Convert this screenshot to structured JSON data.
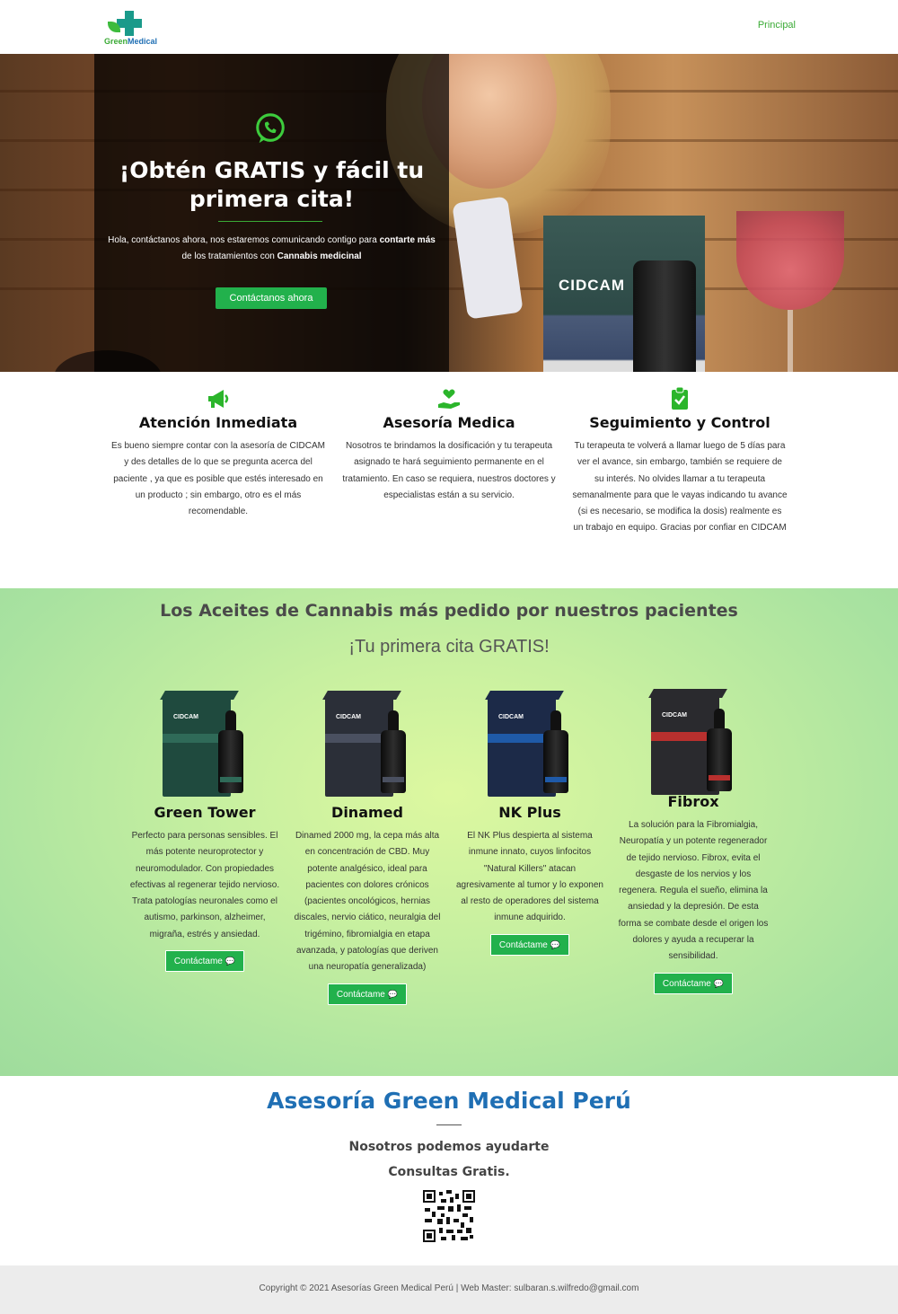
{
  "header": {
    "logo_green": "Green",
    "logo_medical": "Medical",
    "nav_principal": "Principal"
  },
  "hero": {
    "title": "¡Obtén GRATIS y fácil tu primera cita!",
    "text_1": "Hola, contáctanos ahora, nos estaremos comunicando contigo para ",
    "text_bold_1": "contarte más",
    "text_2": " de los tratamientos con ",
    "text_bold_2": "Cannabis medicinal",
    "cta_label": "Contáctanos ahora",
    "photo_box_label": "CIDCAM"
  },
  "features": [
    {
      "icon": "megaphone-icon",
      "title": "Atención Inmediata",
      "text": "Es bueno siempre contar con la asesoría de CIDCAM y des detalles de lo que se pregunta acerca del paciente , ya que es posible que estés interesado en un producto ; sin embargo, otro es el más recomendable."
    },
    {
      "icon": "hand-heart-icon",
      "title": "Asesoría Medica",
      "text": "Nosotros te brindamos la dosificación y tu terapeuta asignado te hará seguimiento permanente en el tratamiento. En caso se requiera, nuestros doctores y especialistas están a su servicio."
    },
    {
      "icon": "clipboard-check-icon",
      "title": "Seguimiento y Control",
      "text": "Tu terapeuta te volverá a llamar luego de 5 días para ver el avance, sin embargo, también se requiere de su interés. No olvides llamar a tu terapeuta semanalmente para que le vayas indicando tu avance (si es necesario, se modifica la dosis) realmente es un trabajo en equipo. Gracias por confiar en CIDCAM"
    }
  ],
  "products_section": {
    "title": "Los Aceites de Cannabis más pedido por nuestros pacientes",
    "subtitle": "¡Tu primera cita GRATIS!",
    "box_brand": "CIDCAM",
    "button_label": "Contáctame",
    "items": [
      {
        "name": "Green Tower",
        "color": "#1f4a3e",
        "band": "#2f6a58",
        "text": "Perfecto para personas sensibles. El más potente neuroprotector y neuromodulador. Con propiedades efectivas al regenerar tejido nervioso. Trata patologías neuronales como el autismo, parkinson, alzheimer, migraña, estrés y ansiedad."
      },
      {
        "name": "Dinamed",
        "color": "#2b2f38",
        "band": "#4a5060",
        "text": "Dinamed 2000 mg,  la cepa más alta en concentración de CBD. Muy potente analgésico, ideal para pacientes con dolores crónicos (pacientes oncológicos, hernias discales, nervio ciático, neuralgia del trigémino, fibromialgia en etapa avanzada, y patologías que deriven una neuropatía generalizada)"
      },
      {
        "name": "NK Plus",
        "color": "#1c2a48",
        "band": "#1f5aa8",
        "text": "El NK Plus despierta al sistema inmune innato, cuyos linfocitos \"Natural Killers\" atacan agresivamente al tumor y lo exponen al resto de operadores del sistema inmune adquirido."
      },
      {
        "name": "Fibrox",
        "color": "#2a2a2e",
        "band": "#b8302e",
        "text": "La solución para la Fibromialgia, Neuropatía y un potente regenerador de tejido nervioso. Fibrox, evita el desgaste de los nervios y los regenera. Regula el sueño, elimina la ansiedad y la depresión. De esta forma se combate desde el origen los dolores y ayuda a recuperar la sensibilidad."
      }
    ]
  },
  "asesoria": {
    "title": "Asesoría Green Medical Perú",
    "line_1": "Nosotros podemos ayudarte",
    "line_2": "Consultas Gratis."
  },
  "footer": {
    "text": "Copyright © 2021 Asesorías Green Medical Perú | Web Master: sulbaran.s.wilfredo@gmail.com"
  },
  "colors": {
    "accent_green": "#22b14c",
    "brand_blue": "#1f6fb4"
  }
}
